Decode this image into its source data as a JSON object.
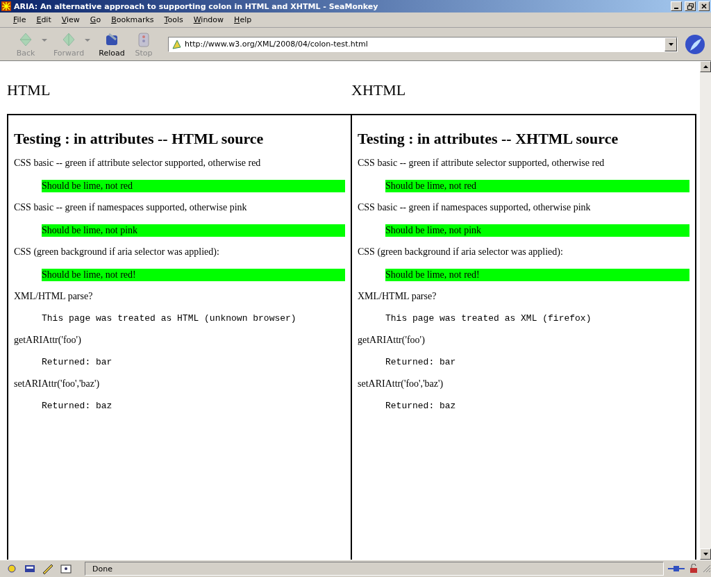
{
  "window": {
    "title": "ARIA: An alternative approach to supporting colon in HTML and XHTML - SeaMonkey"
  },
  "menu": [
    "File",
    "Edit",
    "View",
    "Go",
    "Bookmarks",
    "Tools",
    "Window",
    "Help"
  ],
  "toolbar": [
    {
      "label": "Back",
      "disabled": true,
      "dropdown": true
    },
    {
      "label": "Forward",
      "disabled": true,
      "dropdown": true
    },
    {
      "label": "Reload",
      "disabled": false,
      "dropdown": false
    },
    {
      "label": "Stop",
      "disabled": true,
      "dropdown": false
    }
  ],
  "url": "http://www.w3.org/XML/2008/04/colon-test.html",
  "panels": [
    {
      "heading": "HTML",
      "title": "Testing : in attributes -- HTML source",
      "items": [
        {
          "kind": "text",
          "text": "CSS basic -- green if attribute selector supported, otherwise red"
        },
        {
          "kind": "result",
          "text": "Should be lime, not red"
        },
        {
          "kind": "text",
          "text": "CSS basic -- green if namespaces supported, otherwise pink"
        },
        {
          "kind": "result",
          "text": "Should be lime, not pink"
        },
        {
          "kind": "text",
          "text": "CSS (green background if aria selector was applied):"
        },
        {
          "kind": "result",
          "text": "Should be lime, not red!"
        },
        {
          "kind": "text",
          "text": "XML/HTML parse?"
        },
        {
          "kind": "code",
          "text": "This page was treated as HTML (unknown browser)"
        },
        {
          "kind": "text",
          "text": "getARIAttr('foo')"
        },
        {
          "kind": "code",
          "text": "Returned: bar"
        },
        {
          "kind": "text",
          "text": "setARIAttr('foo','baz')"
        },
        {
          "kind": "code",
          "text": "Returned: baz"
        }
      ]
    },
    {
      "heading": "XHTML",
      "title": "Testing : in attributes -- XHTML source",
      "items": [
        {
          "kind": "text",
          "text": "CSS basic -- green if attribute selector supported, otherwise red"
        },
        {
          "kind": "result",
          "text": "Should be lime, not red"
        },
        {
          "kind": "text",
          "text": "CSS basic -- green if namespaces supported, otherwise pink"
        },
        {
          "kind": "result",
          "text": "Should be lime, not pink"
        },
        {
          "kind": "text",
          "text": "CSS (green background if aria selector was applied):"
        },
        {
          "kind": "result",
          "text": "Should be lime, not red!"
        },
        {
          "kind": "text",
          "text": "XML/HTML parse?"
        },
        {
          "kind": "code",
          "text": "This page was treated as XML (firefox)"
        },
        {
          "kind": "text",
          "text": "getARIAttr('foo')"
        },
        {
          "kind": "code",
          "text": "Returned: bar"
        },
        {
          "kind": "text",
          "text": "setARIAttr('foo','baz')"
        },
        {
          "kind": "code",
          "text": "Returned: baz"
        }
      ]
    }
  ],
  "status_bar": {
    "text": "Done"
  }
}
